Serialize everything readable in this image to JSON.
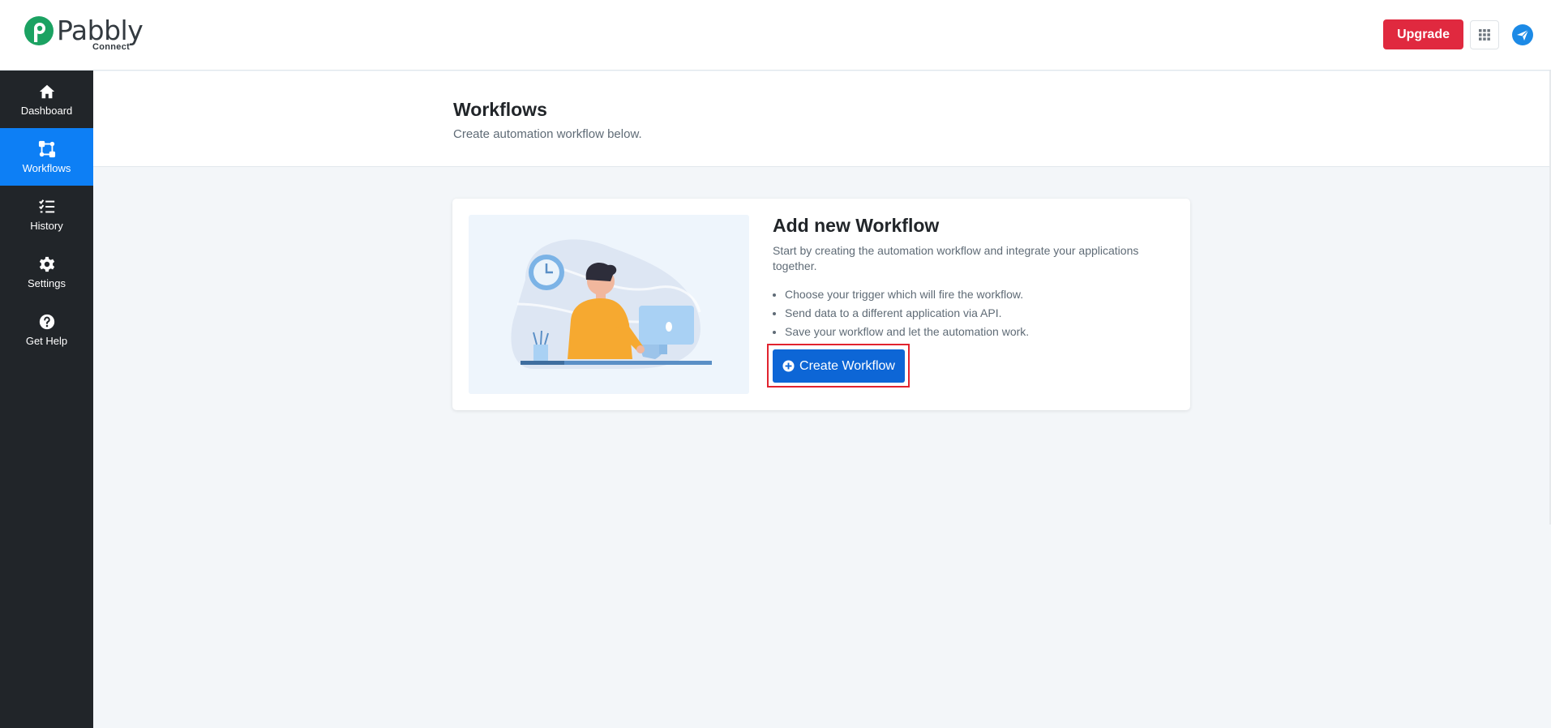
{
  "brand": {
    "name": "Pabbly",
    "product": "Connect",
    "color": "#1ba262"
  },
  "topbar": {
    "upgrade_label": "Upgrade",
    "upgrade_color": "#e0293f",
    "apps_icon": "grid-icon",
    "send_icon": "paper-plane-icon"
  },
  "sidebar": {
    "items": [
      {
        "label": "Dashboard",
        "icon": "home-icon",
        "active": false
      },
      {
        "label": "Workflows",
        "icon": "workflow-icon",
        "active": true
      },
      {
        "label": "History",
        "icon": "checklist-icon",
        "active": false
      },
      {
        "label": "Settings",
        "icon": "gear-icon",
        "active": false
      },
      {
        "label": "Get Help",
        "icon": "help-icon",
        "active": false
      }
    ],
    "active_color": "#0d7ff5"
  },
  "page": {
    "title": "Workflows",
    "subtitle": "Create automation workflow below."
  },
  "card": {
    "title": "Add new Workflow",
    "description": "Start by creating the automation workflow and integrate your applications together.",
    "bullets": [
      "Choose your trigger which will fire the workflow.",
      "Send data to a different application via API.",
      "Save your workflow and let the automation work."
    ],
    "button_label": "Create Workflow",
    "button_color": "#0d66d6"
  }
}
